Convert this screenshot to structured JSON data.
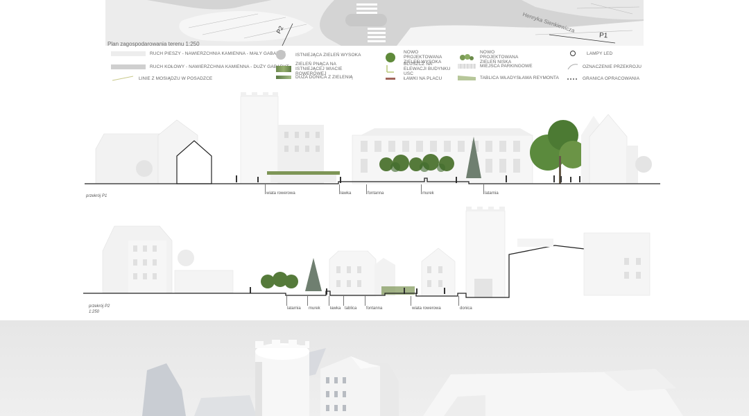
{
  "plan": {
    "title": "Plan zagospodarowania terenu 1:250",
    "street_name": "Henryka Sienkiewicza",
    "marker_p1": "P1",
    "marker_p2": "P2"
  },
  "legend": {
    "items": [
      {
        "label": "RUCH PIESZY - NAWIERZCHNIA KAMIENNA - MAŁY GABARYT"
      },
      {
        "label": "RUCH KOŁOWY - NAWIERZCHNIA KAMIENNA - DUŻY GABARYT"
      },
      {
        "label": "LINIE Z MOSIĄDZU W POSADZCE"
      },
      {
        "label": "ISTNIEJĄCA ZIELEŃ WYSOKA"
      },
      {
        "label": "ZIELEŃ PNĄCA NA ISTNIEJĄCEJ WIACIE ROWEROWEJ"
      },
      {
        "label": "DUŻA DONICA Z ZIELENIĄ"
      },
      {
        "label": "NOWO PROJEKTOWANA ZIELEŃ WYSOKA"
      },
      {
        "label": "BLUSZCZ NA ELEWACJI BUDYNKU USC"
      },
      {
        "label": "ŁAWKI NA PLACU"
      },
      {
        "label": "NOWO PROJEKTOWANA ZIELEŃ NISKA"
      },
      {
        "label": "MIEJSCA PARKINGOWE"
      },
      {
        "label": "TABLICA WŁADYSŁAWA REYMONTA"
      },
      {
        "label": "LAMPY LED"
      },
      {
        "label": "OZNACZENIE PRZEKROJU"
      },
      {
        "label": "GRANICA OPRACOWANIA"
      }
    ]
  },
  "section1": {
    "title": "przekrój P1",
    "labels": [
      "wiata rowerowa",
      "ławka",
      "fontanna",
      "murek",
      "latarnia"
    ]
  },
  "section2": {
    "title": "przekrój P2",
    "scale": "1:250",
    "labels": [
      "latarnia",
      "murek",
      "ławka",
      "tablica",
      "fontanna",
      "wiata rowerowa",
      "donica"
    ]
  }
}
